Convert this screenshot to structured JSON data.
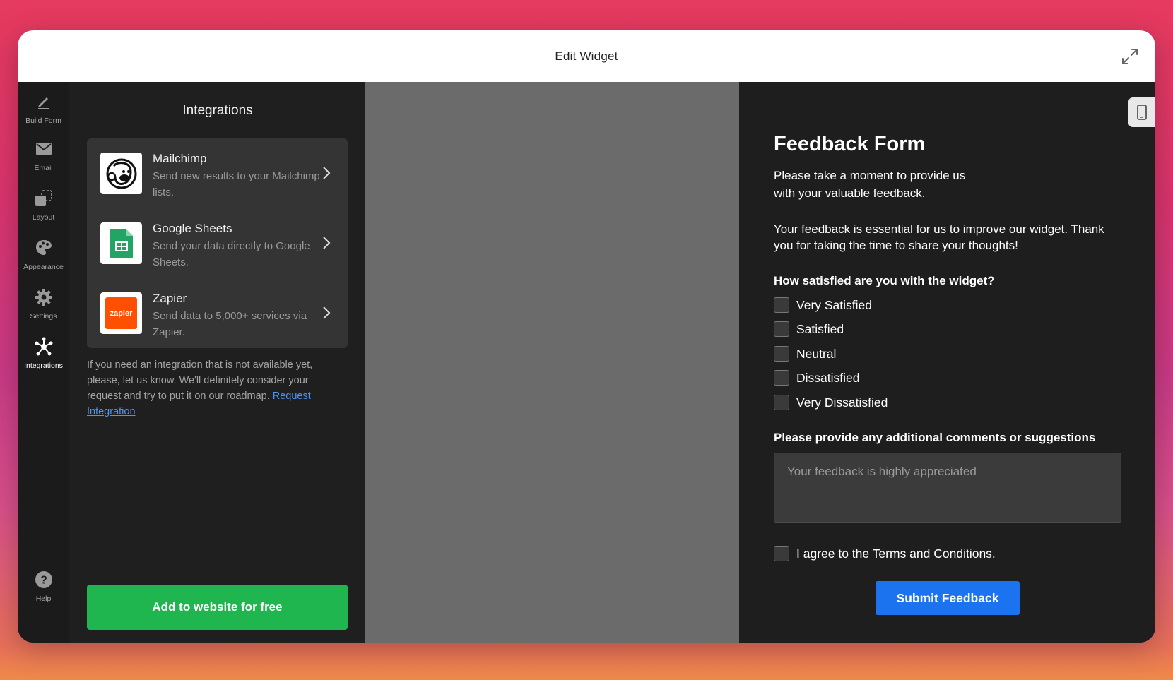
{
  "window": {
    "title": "Edit Widget"
  },
  "rail": {
    "items": [
      {
        "label": "Build Form"
      },
      {
        "label": "Email"
      },
      {
        "label": "Layout"
      },
      {
        "label": "Appearance"
      },
      {
        "label": "Settings"
      },
      {
        "label": "Integrations"
      }
    ],
    "help": {
      "label": "Help"
    }
  },
  "panel": {
    "title": "Integrations",
    "integrations": [
      {
        "name": "Mailchimp",
        "description": "Send new results to your Mailchimp lists."
      },
      {
        "name": "Google Sheets",
        "description": "Send your data directly to Google Sheets."
      },
      {
        "name": "Zapier",
        "description": "Send data to 5,000+ services via Zapier.",
        "logo_text": "zapier"
      }
    ],
    "note": "If you need an integration that is not available yet, please, let us know. We'll definitely consider your request and try to put it on our roadmap.",
    "note_link": "Request Integration",
    "add_button": "Add to website for free"
  },
  "form": {
    "title": "Feedback Form",
    "intro": "Please take a moment to provide us with your valuable feedback.",
    "intro2": "Your feedback is essential for us to improve our widget. Thank you for taking the time to share your thoughts!",
    "question1": "How satisfied are you with the widget?",
    "options": [
      "Very Satisfied",
      "Satisfied",
      "Neutral",
      "Dissatisfied",
      "Very Dissatisfied"
    ],
    "question2": "Please provide any additional comments or suggestions",
    "comments_placeholder": "Your feedback is highly appreciated",
    "terms": "I agree to the Terms and Conditions.",
    "submit": "Submit Feedback"
  },
  "colors": {
    "accent_green": "#1fb64f",
    "accent_blue": "#1c73f0",
    "link_blue": "#4d93f5",
    "zapier_orange": "#ff4f00",
    "sheets_green": "#21a464"
  }
}
